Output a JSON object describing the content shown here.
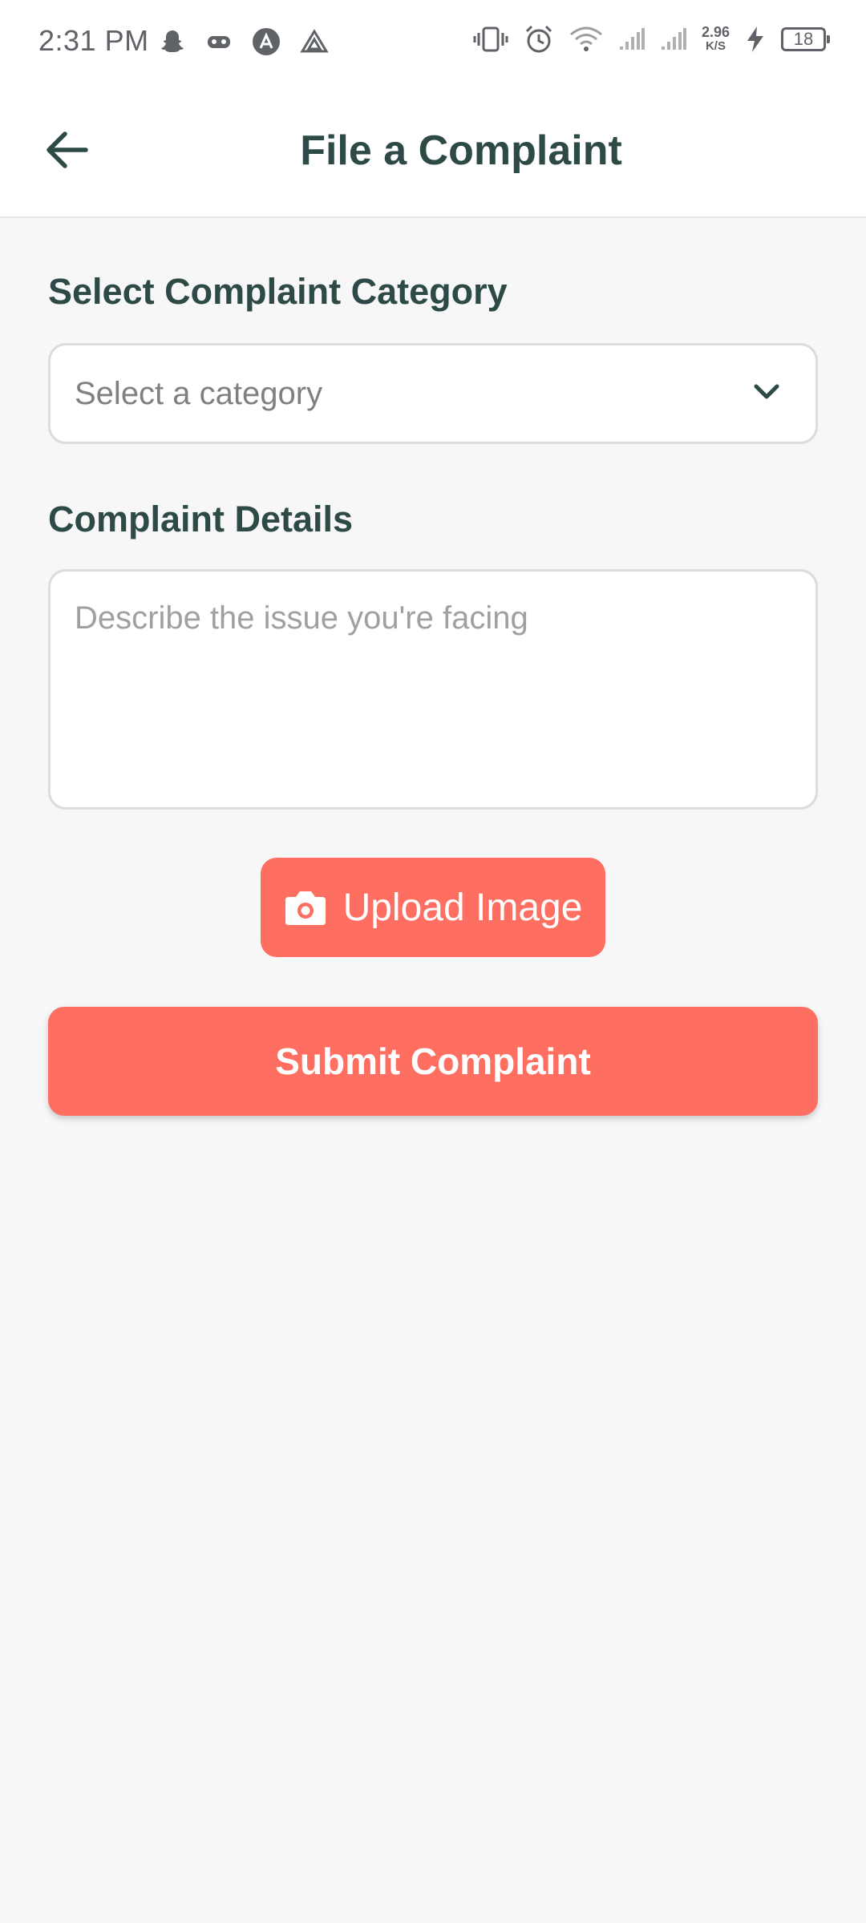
{
  "status_bar": {
    "time": "2:31 PM",
    "net_speed_value": "2.96",
    "net_speed_unit": "K/S",
    "battery_level": "18",
    "left_icons": [
      "snapchat-icon",
      "gamepad-icon",
      "triangle-badge-icon",
      "drive-icon"
    ],
    "right_icons": [
      "vibrate-icon",
      "alarm-icon",
      "wifi-icon",
      "signal-icon",
      "signal-icon",
      "charging-icon"
    ]
  },
  "header": {
    "title": "File a Complaint",
    "back_icon": "arrow-left-icon"
  },
  "form": {
    "category_label": "Select Complaint Category",
    "category_placeholder": "Select a category",
    "details_label": "Complaint Details",
    "details_placeholder": "Describe the issue you're facing",
    "upload_label": "Upload Image",
    "submit_label": "Submit Complaint"
  },
  "colors": {
    "accent": "#ff6f61",
    "title": "#2d4a47",
    "background": "#f7f7f7"
  }
}
